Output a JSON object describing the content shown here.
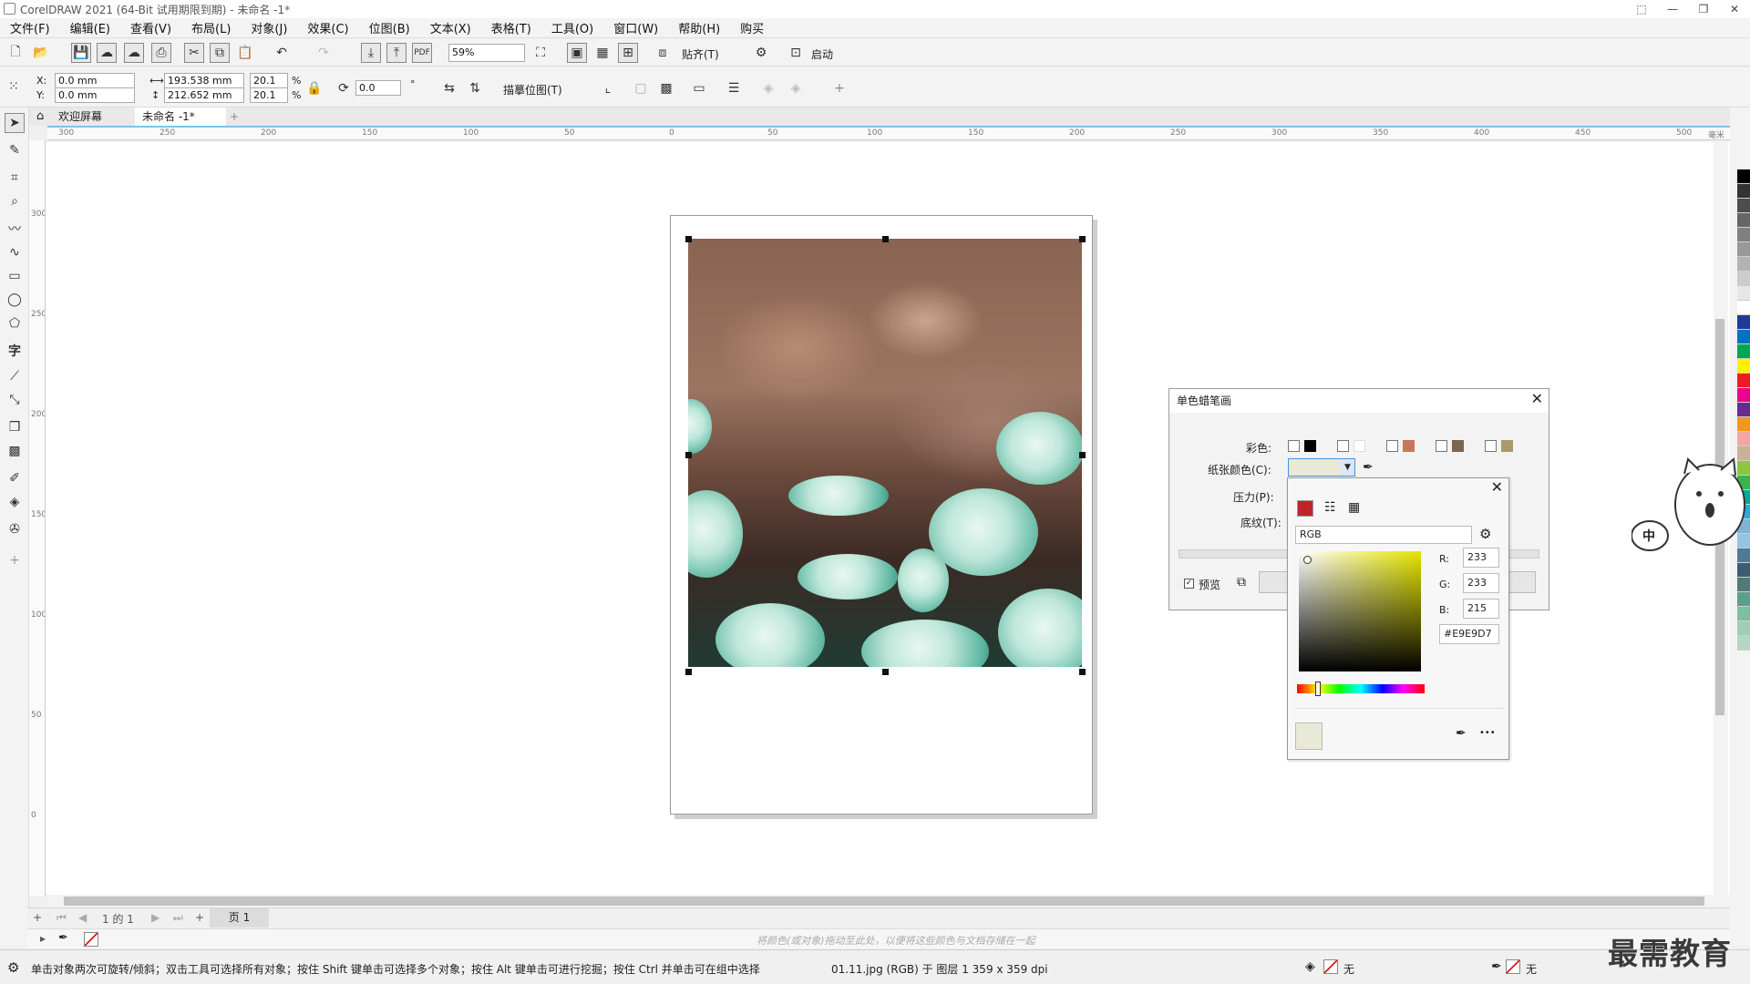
{
  "window": {
    "title": "CorelDRAW 2021 (64-Bit 试用期限到期) - 未命名 -1*",
    "minimize": "—",
    "restore": "❐",
    "close": "✕"
  },
  "menu": [
    "文件(F)",
    "编辑(E)",
    "查看(V)",
    "布局(L)",
    "对象(J)",
    "效果(C)",
    "位图(B)",
    "文本(X)",
    "表格(T)",
    "工具(O)",
    "窗口(W)",
    "帮助(H)",
    "购买"
  ],
  "standard_toolbar": {
    "zoom": "59%",
    "snap_label": "贴齐(T)",
    "launch_label": "启动"
  },
  "property_bar": {
    "x_label": "X:",
    "y_label": "Y:",
    "x": "0.0 mm",
    "y": "0.0 mm",
    "width": "193.538 mm",
    "height": "212.652 mm",
    "scale_w": "20.1",
    "scale_h": "20.1",
    "pct": "%",
    "rotation": "0.0",
    "degree": "°",
    "trace_label": "描摹位图(T)"
  },
  "tabs": {
    "home_icon": "home-icon",
    "welcome": "欢迎屏幕",
    "document": "未命名 -1*",
    "add": "+"
  },
  "hruler_ticks": [
    "300",
    "250",
    "200",
    "150",
    "100",
    "50",
    "0",
    "50",
    "100",
    "150",
    "200",
    "250",
    "300",
    "350",
    "400",
    "450",
    "500"
  ],
  "vruler_ticks": [
    "300",
    "250",
    "200",
    "150",
    "100",
    "50",
    "0"
  ],
  "ruler_unit": "毫米",
  "dialog": {
    "title": "单色蜡笔画",
    "color_label": "彩色:",
    "paper_color_label": "纸张颜色(C):",
    "pressure_label": "压力(P):",
    "texture_label": "底纹(T):",
    "preview_label": "预览",
    "swatch_colors": [
      "#000000",
      "#ffffff",
      "#c8785a",
      "#7a6650",
      "#a89a6e"
    ],
    "paper_color": "#E9E9D7"
  },
  "color_picker": {
    "model": "RGB",
    "r_label": "R:",
    "g_label": "G:",
    "b_label": "B:",
    "r": "233",
    "g": "233",
    "b": "215",
    "hex": "#E9E9D7",
    "more": "•••"
  },
  "page_nav": {
    "page_of": "1 的 1",
    "page_tab": "页 1"
  },
  "color_bar_hint": "将颜色(或对象)拖动至此处，以便将这些颜色与文档存储在一起",
  "status": {
    "hint": "单击对象两次可旋转/倾斜；双击工具可选择所有对象；按住 Shift 键单击可选择多个对象；按住 Alt 键单击可进行挖掘；按住 Ctrl 并单击可在组中选择",
    "object_info": "01.11.jpg (RGB) 于 图层 1 359 x 359 dpi",
    "fill_none": "无",
    "outline_none": "无"
  },
  "watermark": "最需教育",
  "mascot_text": "中",
  "palette_colors": [
    "#000000",
    "#333333",
    "#4d4d4d",
    "#666666",
    "#808080",
    "#999999",
    "#b3b3b3",
    "#cccccc",
    "#e6e6e6",
    "#ffffff",
    "#1f3b99",
    "#0072c6",
    "#00a650",
    "#fff200",
    "#ed1c24",
    "#ec008c",
    "#662d91",
    "#f7941d",
    "#f4a6a6",
    "#c7b299",
    "#8dc63f",
    "#39b54a",
    "#00a99d",
    "#29abe2",
    "#7fb2d6",
    "#99c2e0",
    "#4d7a99",
    "#3d5c73",
    "#507a7a",
    "#5f9e8e",
    "#7fbf9f",
    "#9fcfb0",
    "#b5d6c3"
  ]
}
